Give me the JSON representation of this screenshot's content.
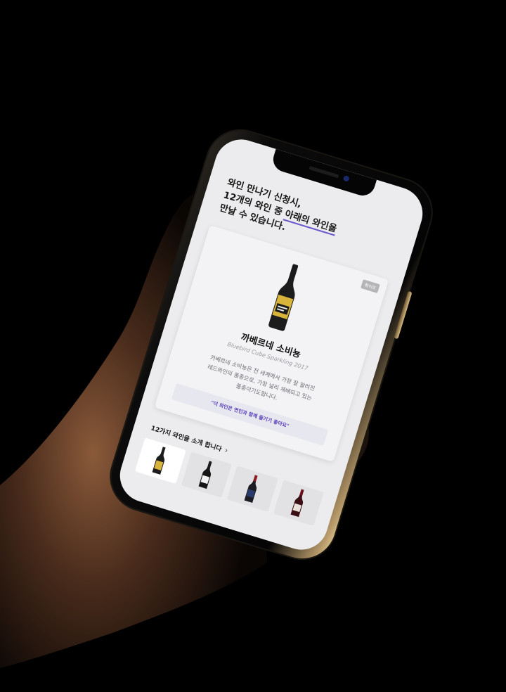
{
  "headline": {
    "line1": "와인 만나기 신청시,",
    "line2_prefix": "12개의 와인 중 ",
    "line2_highlight": "아래의 와인을",
    "line3": "만날 수 있습니다."
  },
  "featured_wine": {
    "badge": "화이트",
    "name": "까베르네 소비뇽",
    "subtitle": "Bluebird Cube Sparkling 2017",
    "description_line1": "카베르네 소비뇽은 전 세계에서 가장 잘 알려진",
    "description_line2": "레드와인의 품종으로, 가장 널리 재배되고 있는",
    "description_line3": "품종이기도합니다.",
    "pairing": "\"이 와인은 연인과 함께 즐기기 좋아요\""
  },
  "wine_list": {
    "title": "12가지 와인을 소개 합니다",
    "chevron": "›"
  },
  "colors": {
    "background": "#000000",
    "screen": "#ececee",
    "accent": "#5a3fb8",
    "gold_frame": "#d9bd86"
  },
  "icons": {
    "chevron": "chevron-right-icon",
    "bottle": "wine-bottle-icon"
  }
}
